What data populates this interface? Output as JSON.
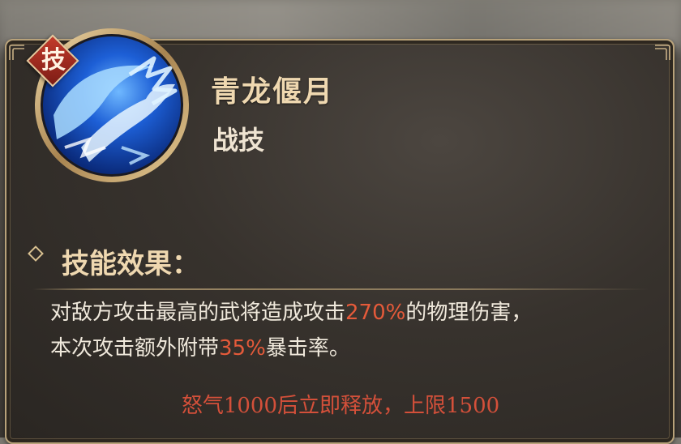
{
  "skill": {
    "badge": "技",
    "name": "青龙偃月",
    "type": "战技",
    "icon": "dragon-wave-icon"
  },
  "effect": {
    "title": "技能效果：",
    "line1_pre": "对敌方攻击最高的武将造成攻击",
    "line1_value": "270%",
    "line1_post": "的物理伤害，",
    "line2_pre": "本次攻击额外附带",
    "line2_value": "35%",
    "line2_post": "暴击率。"
  },
  "footer": {
    "rage_note": "怒气1000后立即释放，上限1500"
  },
  "colors": {
    "highlight": "#e45a3a",
    "title_gold": "#efd8b0",
    "border_gold": "#b8a27a"
  }
}
